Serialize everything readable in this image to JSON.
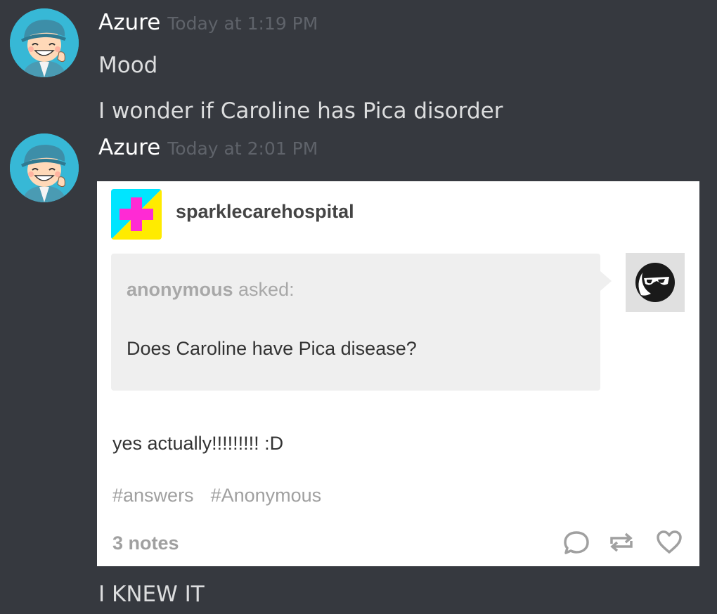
{
  "colors": {
    "background": "#36393f",
    "username": "#ffffff",
    "timestamp": "#5f636a",
    "message_text": "#dcddde",
    "blog_avatar_cyan": "#00e5ff",
    "blog_avatar_yellow": "#ffeb00",
    "blog_avatar_cross": "#ff2ad4"
  },
  "messages": [
    {
      "author": "Azure",
      "timestamp": "Today at 1:19 PM",
      "avatar_icon": "boy-with-cap-avatar",
      "lines": [
        "Mood",
        "I wonder if Caroline has Pica disorder"
      ]
    },
    {
      "author": "Azure",
      "timestamp": "Today at 2:01 PM",
      "avatar_icon": "boy-with-cap-avatar",
      "embed": {
        "blog_icon": "pink-cross-icon",
        "blog_name": "sparklecarehospital",
        "asker_name": "anonymous",
        "asked_suffix": " asked:",
        "question": "Does Caroline have Pica disease?",
        "asker_avatar_icon": "sunglasses-face-icon",
        "answer": "yes actually!!!!!!!!! :D",
        "tags": [
          "#answers",
          "#Anonymous"
        ],
        "notes": "3 notes",
        "actions": [
          "reply-icon",
          "reblog-icon",
          "like-heart-icon"
        ]
      },
      "lines": [
        "I KNEW IT"
      ]
    }
  ]
}
